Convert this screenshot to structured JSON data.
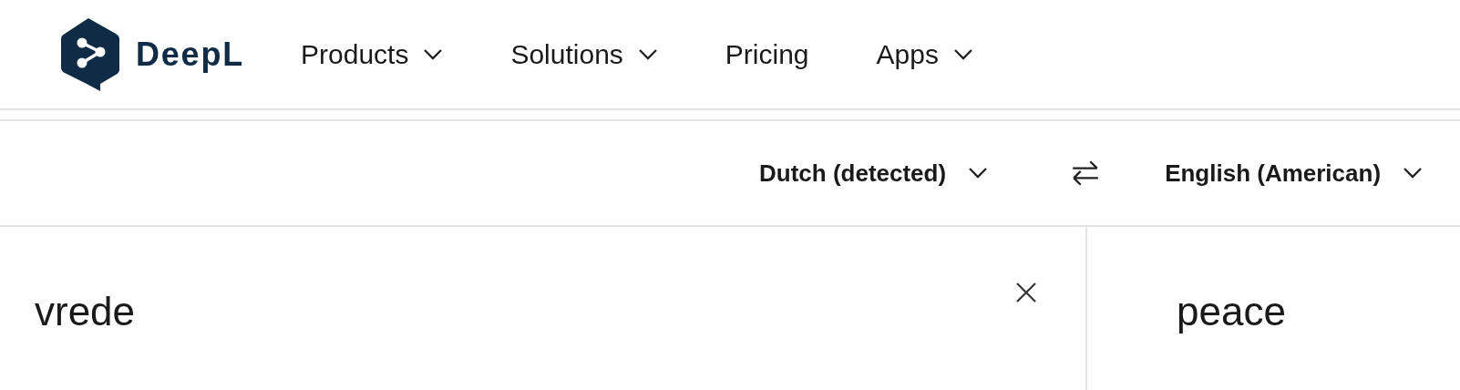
{
  "header": {
    "brand": "DeepL",
    "nav": [
      {
        "label": "Products",
        "has_menu": true
      },
      {
        "label": "Solutions",
        "has_menu": true
      },
      {
        "label": "Pricing",
        "has_menu": false
      },
      {
        "label": "Apps",
        "has_menu": true
      }
    ]
  },
  "languages": {
    "source": "Dutch (detected)",
    "target": "English (American)"
  },
  "source_text": "vrede",
  "target_text": "peace"
}
